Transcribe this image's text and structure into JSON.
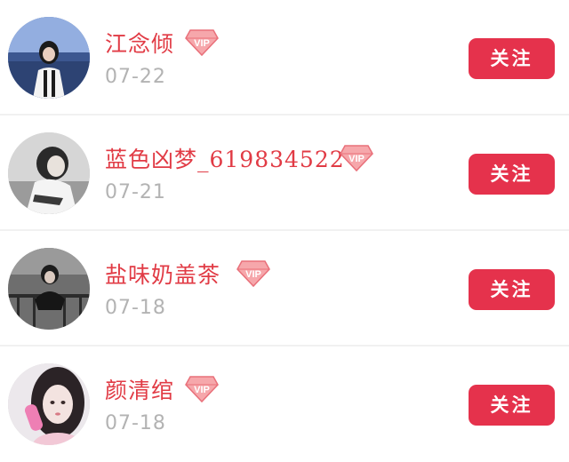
{
  "follow_list": {
    "users": [
      {
        "name": "江念倾",
        "date": "07-22",
        "badge": "VIP",
        "follow_label": "关注"
      },
      {
        "name": "蓝色凶梦_619834522",
        "date": "07-21",
        "badge": "VIP",
        "follow_label": "关注"
      },
      {
        "name": "盐味奶盖茶",
        "date": "07-18",
        "badge": "VIP",
        "follow_label": "关注"
      },
      {
        "name": "颜清绾",
        "date": "07-18",
        "badge": "VIP",
        "follow_label": "关注"
      }
    ]
  },
  "colors": {
    "name": "#e13b45",
    "date": "#b3b3b3",
    "button_bg": "#e5324c",
    "button_text": "#ffffff",
    "divider": "#f1f1f1",
    "vip_badge": "#f07a80"
  },
  "icons": {
    "badge": "vip-diamond-icon"
  }
}
